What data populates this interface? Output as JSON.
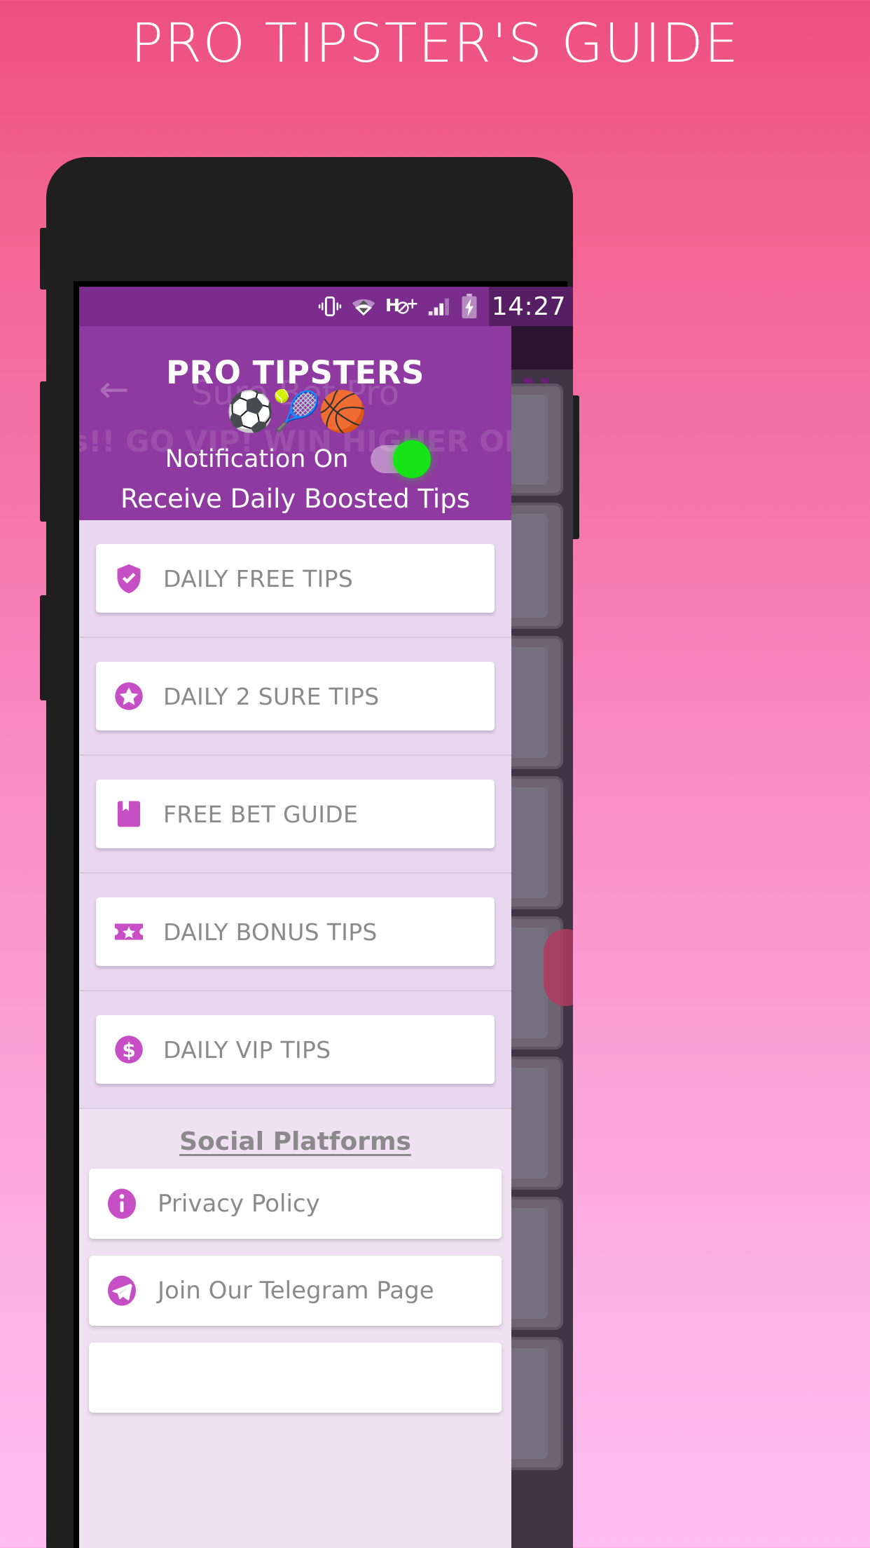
{
  "promo": {
    "title": "PRO TIPSTER'S GUIDE"
  },
  "status_bar": {
    "time": "14:27",
    "icons": [
      "vibrate-icon",
      "wifi-icon",
      "hspa-plus-icon",
      "signal-bars-icon",
      "battery-charging-icon"
    ],
    "network_label": "H+"
  },
  "drawer_header": {
    "title": "PRO TIPSTERS",
    "balls": "⚽🎾🏀",
    "notification_label": "Notification On",
    "notification_state": "on",
    "subtitle": "Receive Daily Boosted Tips",
    "ghost_title": "Sure Bet Pro",
    "ghost_subtitle": "ps!! GO VIP! WIN HIGHER ODDS",
    "back_arrow": "←",
    "bg_color": "#8e3aa0"
  },
  "menu": {
    "items": [
      {
        "label": "DAILY FREE TIPS",
        "icon": "shield-check-icon"
      },
      {
        "label": "DAILY 2 SURE TIPS",
        "icon": "star-circle-icon"
      },
      {
        "label": "FREE BET GUIDE",
        "icon": "bookmark-icon"
      },
      {
        "label": "DAILY BONUS TIPS",
        "icon": "ticket-star-icon"
      },
      {
        "label": "DAILY VIP TIPS",
        "icon": "dollar-circle-icon"
      }
    ]
  },
  "social": {
    "heading": "Social Platforms",
    "rows": [
      {
        "label": "Privacy Policy",
        "icon": "info-circle-icon"
      },
      {
        "label": "Join Our Telegram Page",
        "icon": "telegram-icon"
      }
    ]
  },
  "background": {
    "under_letter": "N"
  },
  "colors": {
    "accent_purple": "#8e3aa0",
    "icon_magenta": "#c64fc6",
    "toggle_on": "#16e416",
    "page_gradient_top": "#ed4f80",
    "page_gradient_bottom": "#ffbdf0"
  }
}
